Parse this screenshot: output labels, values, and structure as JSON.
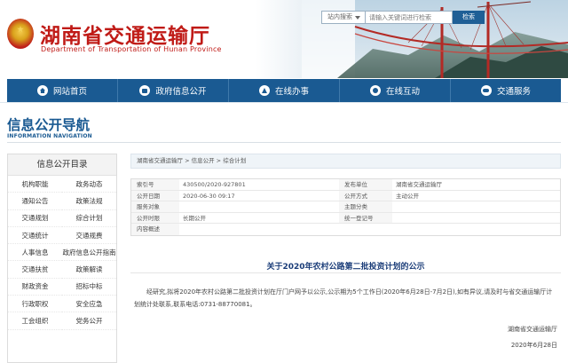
{
  "header": {
    "title": "湖南省交通运输厅",
    "subtitle": "Department of Transportation of Hunan Province"
  },
  "search": {
    "scope": "站内搜索",
    "placeholder": "请输入关键词进行检索",
    "button": "检索"
  },
  "nav": {
    "items": [
      {
        "label": "网站首页",
        "icon": "home-icon"
      },
      {
        "label": "政府信息公开",
        "icon": "government-icon"
      },
      {
        "label": "在线办事",
        "icon": "online-service-icon"
      },
      {
        "label": "在线互动",
        "icon": "chat-icon"
      },
      {
        "label": "交通服务",
        "icon": "traffic-icon"
      }
    ]
  },
  "guide": {
    "title": "信息公开导航",
    "subtitle": "INFORMATION NAVIGATION"
  },
  "sidebar": {
    "heading": "信息公开目录",
    "items": [
      "机构职能",
      "政务动态",
      "通知公告",
      "政策法规",
      "交通规划",
      "综合计划",
      "交通统计",
      "交通规费",
      "人事信息",
      "政府信息公开指南",
      "交通扶贫",
      "政策解读",
      "财政资金",
      "招标中标",
      "行政职权",
      "安全应急",
      "工会组织",
      "党务公开"
    ]
  },
  "breadcrumb": {
    "items": [
      "湖南省交通运输厅",
      "信息公开",
      "综合计划"
    ],
    "separator": " > "
  },
  "meta": {
    "index_label": "索引号",
    "index_value": "430500/2020-927801",
    "publisher_label": "发布单位",
    "publisher_value": "湖南省交通运输厅",
    "date_label": "公开日期",
    "date_value": "2020-06-30 09:17",
    "method_label": "公开方式",
    "method_value": "主动公开",
    "target_label": "服务对象",
    "target_value": "",
    "category_label": "主题分类",
    "category_value": "",
    "period_label": "公开时限",
    "period_value": "长期公开",
    "code_label": "统一登记号",
    "code_value": "",
    "summary_label": "内容概述",
    "summary_value": ""
  },
  "article": {
    "title": "关于2020年农村公路第二批投资计划的公示",
    "body": "经研究,拟将2020年农村公路第二批投资计划在厅门户网予以公示,公示期为5个工作日(2020年6月28日-7月2日),如有异议,请及时与省交通运输厅计划统计处联系,联系电话:0731-88770081。",
    "signature": "湖南省交通运输厅",
    "date": "2020年6月28日"
  }
}
